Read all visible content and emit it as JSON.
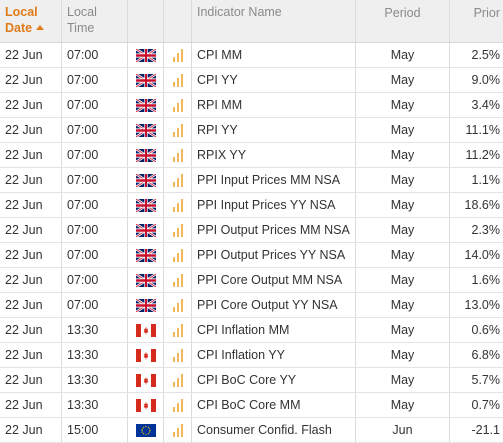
{
  "header": {
    "date_line1": "Local",
    "date_line2": "Date",
    "time_line1": "Local",
    "time_line2": "Time",
    "name": "Indicator Name",
    "period": "Period",
    "prior": "Prior"
  },
  "colors": {
    "sort_accent": "#e07b1a",
    "importance_bars": "#f0b75b"
  },
  "rows": [
    {
      "date": "22 Jun",
      "time": "07:00",
      "flag": "uk-flag-icon",
      "indicator": "CPI MM",
      "period": "May",
      "prior": "2.5%"
    },
    {
      "date": "22 Jun",
      "time": "07:00",
      "flag": "uk-flag-icon",
      "indicator": "CPI YY",
      "period": "May",
      "prior": "9.0%"
    },
    {
      "date": "22 Jun",
      "time": "07:00",
      "flag": "uk-flag-icon",
      "indicator": "RPI MM",
      "period": "May",
      "prior": "3.4%"
    },
    {
      "date": "22 Jun",
      "time": "07:00",
      "flag": "uk-flag-icon",
      "indicator": "RPI YY",
      "period": "May",
      "prior": "11.1%"
    },
    {
      "date": "22 Jun",
      "time": "07:00",
      "flag": "uk-flag-icon",
      "indicator": "RPIX YY",
      "period": "May",
      "prior": "11.2%"
    },
    {
      "date": "22 Jun",
      "time": "07:00",
      "flag": "uk-flag-icon",
      "indicator": "PPI Input Prices MM NSA",
      "period": "May",
      "prior": "1.1%"
    },
    {
      "date": "22 Jun",
      "time": "07:00",
      "flag": "uk-flag-icon",
      "indicator": "PPI Input Prices YY NSA",
      "period": "May",
      "prior": "18.6%"
    },
    {
      "date": "22 Jun",
      "time": "07:00",
      "flag": "uk-flag-icon",
      "indicator": "PPI Output Prices MM NSA",
      "period": "May",
      "prior": "2.3%"
    },
    {
      "date": "22 Jun",
      "time": "07:00",
      "flag": "uk-flag-icon",
      "indicator": "PPI Output Prices YY NSA",
      "period": "May",
      "prior": "14.0%"
    },
    {
      "date": "22 Jun",
      "time": "07:00",
      "flag": "uk-flag-icon",
      "indicator": "PPI Core Output MM NSA",
      "period": "May",
      "prior": "1.6%"
    },
    {
      "date": "22 Jun",
      "time": "07:00",
      "flag": "uk-flag-icon",
      "indicator": "PPI Core Output YY NSA",
      "period": "May",
      "prior": "13.0%"
    },
    {
      "date": "22 Jun",
      "time": "13:30",
      "flag": "canada-flag-icon",
      "indicator": "CPI Inflation MM",
      "period": "May",
      "prior": "0.6%"
    },
    {
      "date": "22 Jun",
      "time": "13:30",
      "flag": "canada-flag-icon",
      "indicator": "CPI Inflation YY",
      "period": "May",
      "prior": "6.8%"
    },
    {
      "date": "22 Jun",
      "time": "13:30",
      "flag": "canada-flag-icon",
      "indicator": "CPI BoC Core YY",
      "period": "May",
      "prior": "5.7%"
    },
    {
      "date": "22 Jun",
      "time": "13:30",
      "flag": "canada-flag-icon",
      "indicator": "CPI BoC Core MM",
      "period": "May",
      "prior": "0.7%"
    },
    {
      "date": "22 Jun",
      "time": "15:00",
      "flag": "eu-flag-icon",
      "indicator": "Consumer Confid. Flash",
      "period": "Jun",
      "prior": "-21.1"
    }
  ]
}
